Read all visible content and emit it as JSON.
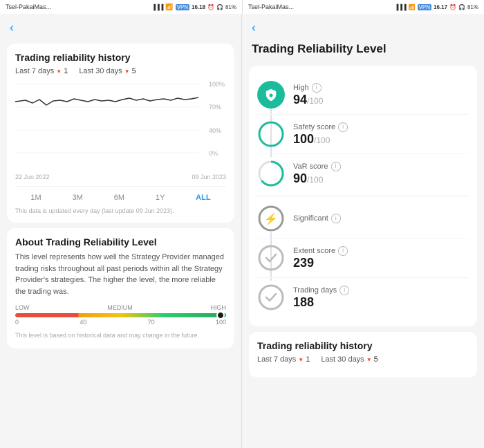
{
  "left_panel": {
    "status": {
      "carrier": "Tsel-PakaiMas...",
      "wifi": "WiFi",
      "vpn": "VPN",
      "time": "16.18",
      "battery": "81%"
    },
    "back_label": "‹",
    "chart_title": "Trading reliability history",
    "period_7d_label": "Last 7 days",
    "period_7d_value": "1",
    "period_30d_label": "Last 30 days",
    "period_30d_value": "5",
    "chart_y_labels": [
      "100%",
      "70%",
      "40%",
      "0%"
    ],
    "chart_date_start": "22 Jun 2022",
    "chart_date_end": "09 Jun 2023",
    "time_tabs": [
      "1M",
      "3M",
      "6M",
      "1Y",
      "ALL"
    ],
    "active_tab": "ALL",
    "update_note": "This data is updated every day (last update 09 Jun 2023).",
    "about_title": "About Trading Reliability Level",
    "about_text": "This level represents how well the Strategy Provider managed trading risks throughout all past periods within all the Strategy Provider's strategies. The higher the level, the more reliable the trading was.",
    "bar_labels": [
      "LOW",
      "MEDIUM",
      "HIGH"
    ],
    "bar_ticks": [
      "0",
      "40",
      "70",
      "100"
    ],
    "disclaimer": "This level is based on historical data and may change in the future."
  },
  "right_panel": {
    "status": {
      "carrier": "Tsel-PakaiMas...",
      "wifi": "WiFi",
      "vpn": "VPN",
      "time": "16.17",
      "battery": "81%"
    },
    "back_label": "‹",
    "title": "Trading Reliability Level",
    "metrics": [
      {
        "icon_type": "shield",
        "level_label": "High",
        "label": "High",
        "value": "94",
        "denom": "/100",
        "has_info": true
      },
      {
        "icon_type": "circle-full",
        "label": "Safety score",
        "value": "100",
        "denom": "/100",
        "has_info": true
      },
      {
        "icon_type": "circle-partial",
        "label": "VaR score",
        "value": "90",
        "denom": "/100",
        "has_info": true
      },
      {
        "icon_type": "circle-bolt",
        "level_label": "Significant",
        "label": "Significant",
        "value": "",
        "denom": "",
        "has_info": true
      },
      {
        "icon_type": "circle-check",
        "label": "Extent score",
        "value": "239",
        "denom": "",
        "has_info": true
      },
      {
        "icon_type": "circle-check",
        "label": "Trading days",
        "value": "188",
        "denom": "",
        "has_info": true
      }
    ],
    "history_title": "Trading reliability history",
    "period_7d_label": "Last 7 days",
    "period_7d_value": "1",
    "period_30d_label": "Last 30 days",
    "period_30d_value": "5"
  }
}
